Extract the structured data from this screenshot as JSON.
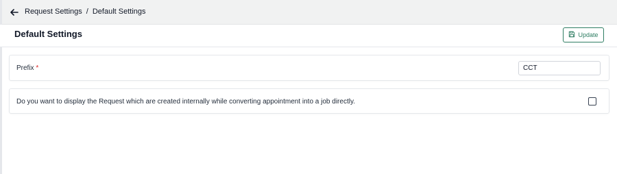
{
  "breadcrumb": {
    "items": [
      "Request Settings",
      "Default Settings"
    ],
    "separator": "/"
  },
  "header": {
    "title": "Default Settings",
    "update_label": "Update"
  },
  "form": {
    "prefix": {
      "label": "Prefix",
      "required_marker": "*",
      "value": "CCT"
    },
    "display_internal_requests": {
      "label": "Do you want to display the Request which are created internally while converting appointment into a job directly.",
      "checked": false
    }
  },
  "icons": {
    "back": "arrow-left-icon",
    "update": "save-icon"
  },
  "colors": {
    "accent": "#2e7d62",
    "required": "#dc2626",
    "breadcrumb_bg": "#f1f2f2"
  }
}
